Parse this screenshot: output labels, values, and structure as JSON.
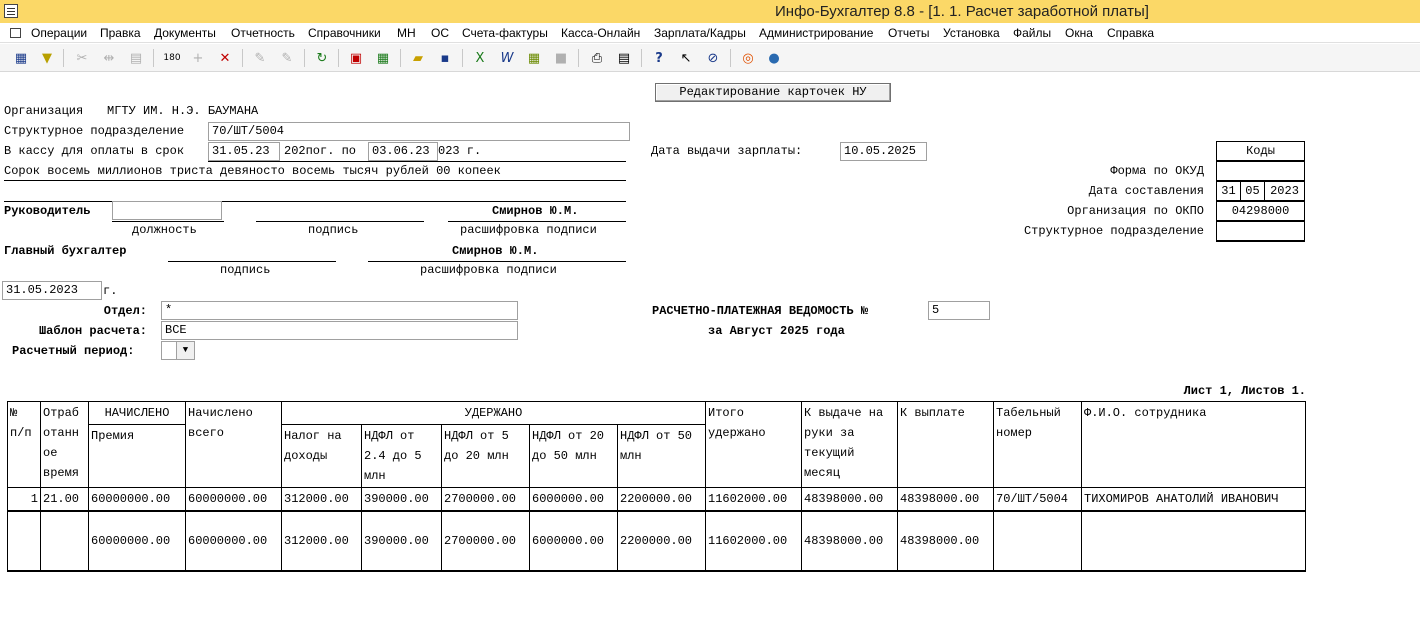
{
  "window": {
    "title": "Инфо-Бухгалтер 8.8 - [1. 1. Расчет заработной платы]"
  },
  "menu": [
    "Операции",
    "Правка",
    "Документы",
    "Отчетность",
    "Справочники",
    "МН",
    "ОС",
    "Счета-фактуры",
    "Касса-Онлайн",
    "Зарплата/Кадры",
    "Администрирование",
    "Отчеты",
    "Установка",
    "Файлы",
    "Окна",
    "Справка"
  ],
  "toolbar_icons": [
    "table-icon",
    "filter-icon",
    "cut-icon",
    "split-icon",
    "paste-icon",
    "number-format-icon",
    "add-icon",
    "delete-icon",
    "tool1-icon",
    "tool2-icon",
    "refresh-icon",
    "pdf-icon",
    "calculator-icon",
    "open-folder-icon",
    "save-icon",
    "excel-icon",
    "word-icon",
    "calc-sheet-icon",
    "gray-box-icon",
    "print-icon",
    "preview-icon",
    "help-icon",
    "context-help-icon",
    "compass-icon",
    "support-icon",
    "web-icon"
  ],
  "edit_cards_button": "Редактирование карточек НУ",
  "org": {
    "label": "Организация",
    "value": "МГТУ ИМ. Н.Э. БАУМАНА"
  },
  "subdivision": {
    "label": "Структурное подразделение",
    "value": "70/ШТ/5004"
  },
  "cash": {
    "label": "В кассу для оплаты в срок",
    "from": "31.05.23",
    "mid": "202пог. по",
    "to": "03.06.23",
    "tail": "023 г."
  },
  "pay_date": {
    "label": "Дата выдачи зарплаты:",
    "value": "10.05.2025"
  },
  "amount_words": "Сорок восемь миллионов триста девяносто восемь тысяч рублей 00 копеек",
  "codes": {
    "header": "Коды",
    "okud_label": "Форма по ОКУД",
    "date_label": "Дата составления",
    "date_d": "31",
    "date_m": "05",
    "date_y": "2023",
    "okpo_label": "Организация по ОКПО",
    "okpo_value": "04298000",
    "sub_label": "Структурное подразделение"
  },
  "head": {
    "label": "Руководитель",
    "position_caption": "должность",
    "sign_caption": "подпись",
    "name": "Смирнов Ю.М.",
    "decode_caption": "расшифровка подписи"
  },
  "chief": {
    "label": "Главный бухгалтер",
    "sign_caption": "подпись",
    "name": "Смирнов Ю.М.",
    "decode_caption": "расшифровка подписи"
  },
  "doc_date": {
    "value": "31.05.2023",
    "suffix": "г."
  },
  "filters": {
    "dept_label": "Отдел:",
    "dept_value": "*",
    "template_label": "Шаблон расчета:",
    "template_value": "ВСЕ",
    "period_label": "Расчетный период:",
    "period_value": ""
  },
  "statement": {
    "title": "РАСЧЕТНО-ПЛАТЕЖНАЯ ВЕДОМОСТЬ №",
    "number": "5",
    "period": "за Август 2025 года"
  },
  "sheet_info": "Лист 1, Листов 1.",
  "table": {
    "h_num": "№ п/п",
    "h_worked": "Отраб отанн ое время",
    "h_accrued": "НАЧИСЛЕНО",
    "h_bonus": "Премия",
    "h_total_accrued": "Начислено всего",
    "h_withheld": "УДЕРЖАНО",
    "h_tax": "Налог на доходы",
    "h_ndfl1": "НДФЛ от 2.4 до 5 млн",
    "h_ndfl2": "НДФЛ от 5 до 20 млн",
    "h_ndfl3": "НДФЛ от 20 до 50 млн",
    "h_ndfl4": "НДФЛ от 50 млн",
    "h_total_withheld": "Итого удержано",
    "h_to_issue": "К выдаче на руки за текущий месяц",
    "h_to_pay": "К выплате",
    "h_tab": "Табельный номер",
    "h_fio": "Ф.И.О. сотрудника",
    "row": {
      "n": "1",
      "worked": "21.00",
      "bonus": "60000000.00",
      "total": "60000000.00",
      "tax": "312000.00",
      "n1": "390000.00",
      "n2": "2700000.00",
      "n3": "6000000.00",
      "n4": "2200000.00",
      "wh": "11602000.00",
      "issue": "48398000.00",
      "pay": "48398000.00",
      "tab": "70/ШТ/5004",
      "fio": "ТИХОМИРОВ АНАТОЛИЙ ИВАНОВИЧ"
    },
    "sum": {
      "bonus": "60000000.00",
      "total": "60000000.00",
      "tax": "312000.00",
      "n1": "390000.00",
      "n2": "2700000.00",
      "n3": "6000000.00",
      "n4": "2200000.00",
      "wh": "11602000.00",
      "issue": "48398000.00",
      "pay": "48398000.00"
    }
  }
}
